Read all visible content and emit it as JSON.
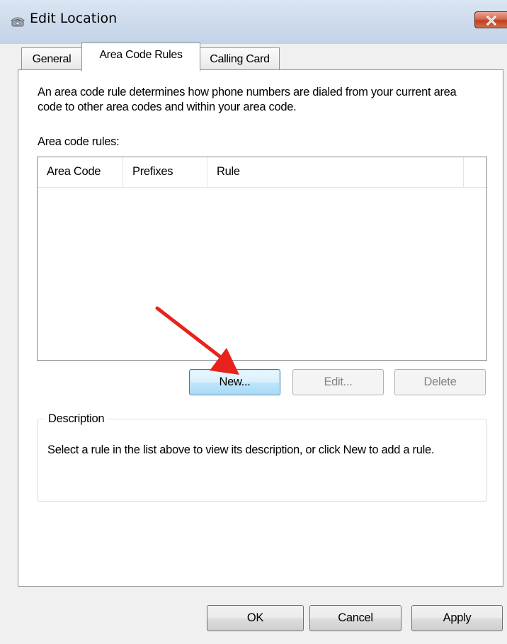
{
  "window": {
    "title": "Edit Location",
    "title_icon": "telephone-location-icon",
    "close_icon": "close-icon"
  },
  "tabs": [
    {
      "label": "General",
      "selected": false
    },
    {
      "label": "Area Code Rules",
      "selected": true
    },
    {
      "label": "Calling Card",
      "selected": false
    }
  ],
  "content": {
    "intro": "An area code rule determines how phone numbers are dialed from your current area code to other area codes and within your area code.",
    "rules_label": "Area code rules:",
    "columns": [
      "Area Code",
      "Prefixes",
      "Rule"
    ],
    "rows": []
  },
  "buttons": {
    "new": "New...",
    "edit": "Edit...",
    "delete": "Delete",
    "ok": "OK",
    "cancel": "Cancel",
    "apply": "Apply"
  },
  "description": {
    "title": "Description",
    "text": "Select a rule in the list above to view its description, or click New to add a rule."
  },
  "annotation": {
    "icon": "red-arrow-icon",
    "color": "#e8231c"
  }
}
